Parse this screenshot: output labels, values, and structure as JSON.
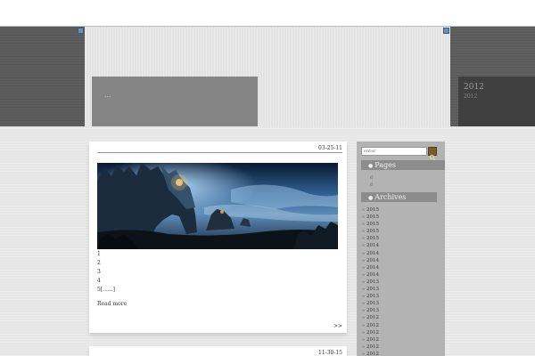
{
  "header": {
    "site_title": "...",
    "date_year": "2012",
    "date_sub": "2012"
  },
  "posts": [
    {
      "date": "03-25-11",
      "lines": [
        "1",
        "2",
        "3",
        "4",
        "5[......]"
      ],
      "read_more": "Read more",
      "next": ">>"
    },
    {
      "date": "11-30-15"
    }
  ],
  "sidebar": {
    "search_placeholder": "enter",
    "pages_title": "Pages",
    "pages": [
      "e",
      "e"
    ],
    "archives_title": "Archives",
    "archives": [
      "2015",
      "2015",
      "2015",
      "2015",
      "2015",
      "2014",
      "2014",
      "2014",
      "2014",
      "2014",
      "2013",
      "2013",
      "2013",
      "2013",
      "2013",
      "2012",
      "2012",
      "2012",
      "2012",
      "2012",
      "2012"
    ]
  },
  "icons": {
    "corner_left": "square-icon",
    "corner_right": "square-icon",
    "search": "search-icon",
    "bullet": "bullet-icon"
  },
  "colors": {
    "header_band": "#e2e2e2",
    "side_panel": "#5e5e5e",
    "title_box": "#858585",
    "sidebar": "#b3b3b3",
    "widget_title": "#8c8c8c",
    "search_button": "#7a5a2a"
  }
}
